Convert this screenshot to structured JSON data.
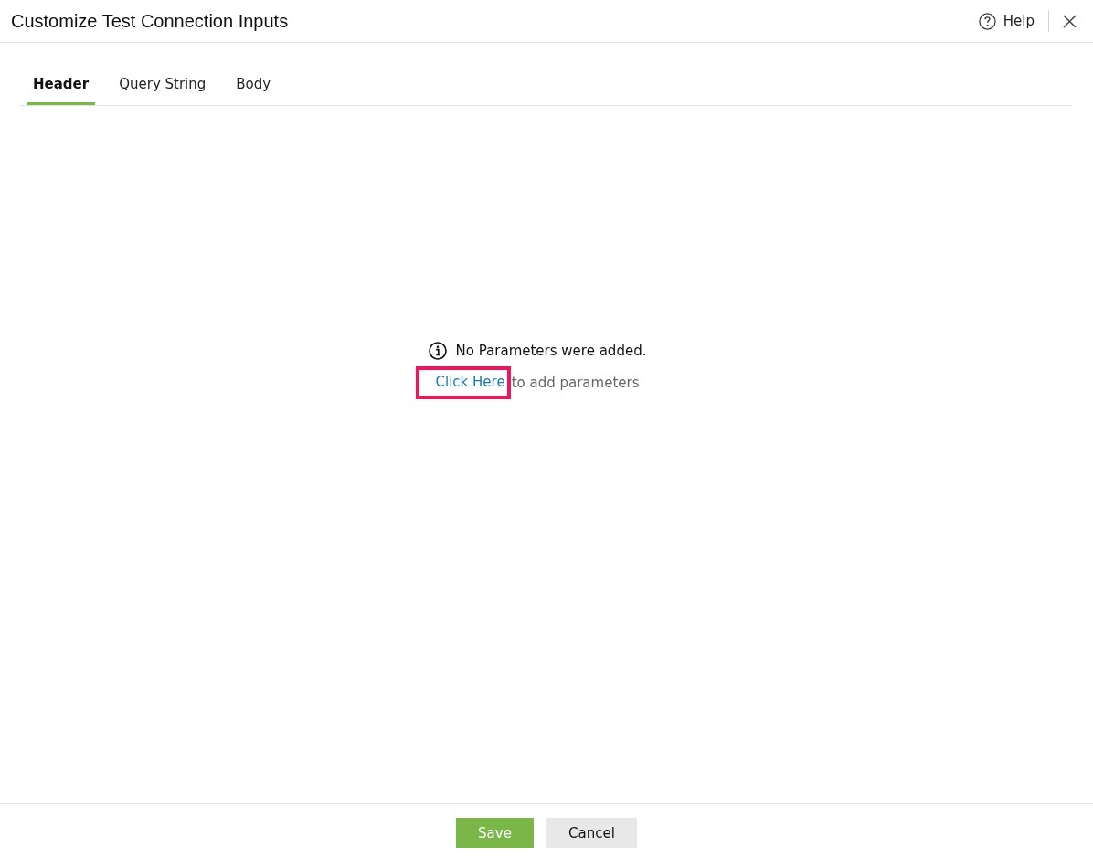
{
  "dialog": {
    "title": "Customize Test Connection Inputs",
    "help": {
      "label": "Help"
    }
  },
  "tabs": [
    {
      "label": "Header",
      "selected": true
    },
    {
      "label": "Query String",
      "selected": false
    },
    {
      "label": "Body",
      "selected": false
    }
  ],
  "empty_state": {
    "message": "No Parameters were added.",
    "link": {
      "label": "Click Here",
      "highlighted": true
    },
    "suffix": "to add parameters"
  },
  "buttons": [
    {
      "label": "Save",
      "kind": "primary"
    },
    {
      "label": "Cancel",
      "kind": "secondary"
    }
  ]
}
